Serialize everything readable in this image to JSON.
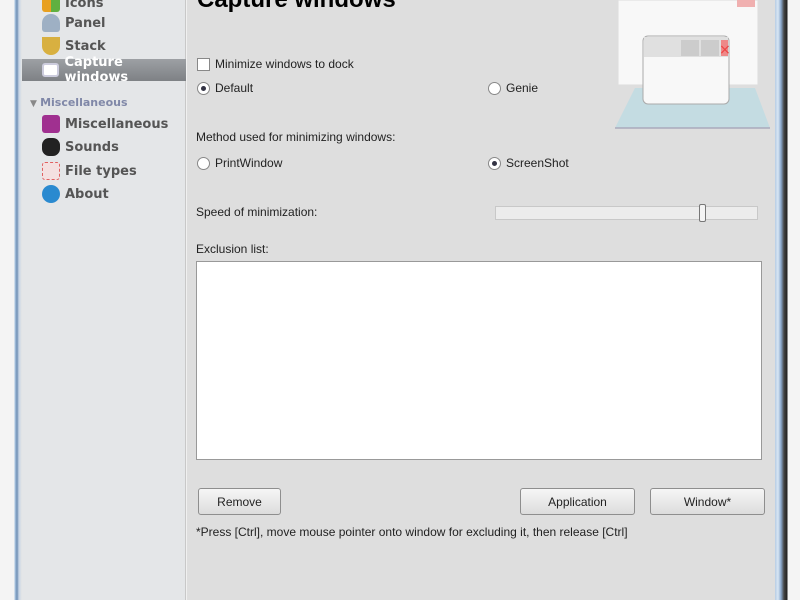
{
  "sidebar": {
    "items": [
      {
        "label": "Icons",
        "icon": "icons-icon",
        "color": "#e8a020"
      },
      {
        "label": "Panel",
        "icon": "panel-icon",
        "color": "#8aa0b8"
      },
      {
        "label": "Stack",
        "icon": "stack-icon",
        "color": "#d8b040"
      },
      {
        "label": "Capture windows",
        "icon": "capture-windows-icon",
        "color": "#ffffff",
        "selected": true
      }
    ],
    "group": "Miscellaneous",
    "group_items": [
      {
        "label": "Miscellaneous",
        "icon": "miscellaneous-icon",
        "color": "#a03090"
      },
      {
        "label": "Sounds",
        "icon": "sounds-icon",
        "color": "#222222"
      },
      {
        "label": "File types",
        "icon": "file-types-icon",
        "color": "#e06060"
      },
      {
        "label": "About",
        "icon": "about-icon",
        "color": "#2a8ad0"
      }
    ]
  },
  "main": {
    "title": "Capture windows",
    "minimize_to_dock": {
      "label": "Minimize windows to dock",
      "checked": false
    },
    "effect": {
      "default_label": "Default",
      "genie_label": "Genie",
      "selected": "Default"
    },
    "method": {
      "label": "Method used for minimizing windows:",
      "printwindow_label": "PrintWindow",
      "screenshot_label": "ScreenShot",
      "selected": "ScreenShot"
    },
    "speed": {
      "label": "Speed of minimization:",
      "value": 0.8
    },
    "exclusion": {
      "label": "Exclusion list:",
      "items": []
    },
    "buttons": {
      "remove": "Remove",
      "application": "Application",
      "window": "Window*"
    },
    "hint": "*Press [Ctrl], move mouse pointer onto window for excluding it, then release [Ctrl]"
  }
}
